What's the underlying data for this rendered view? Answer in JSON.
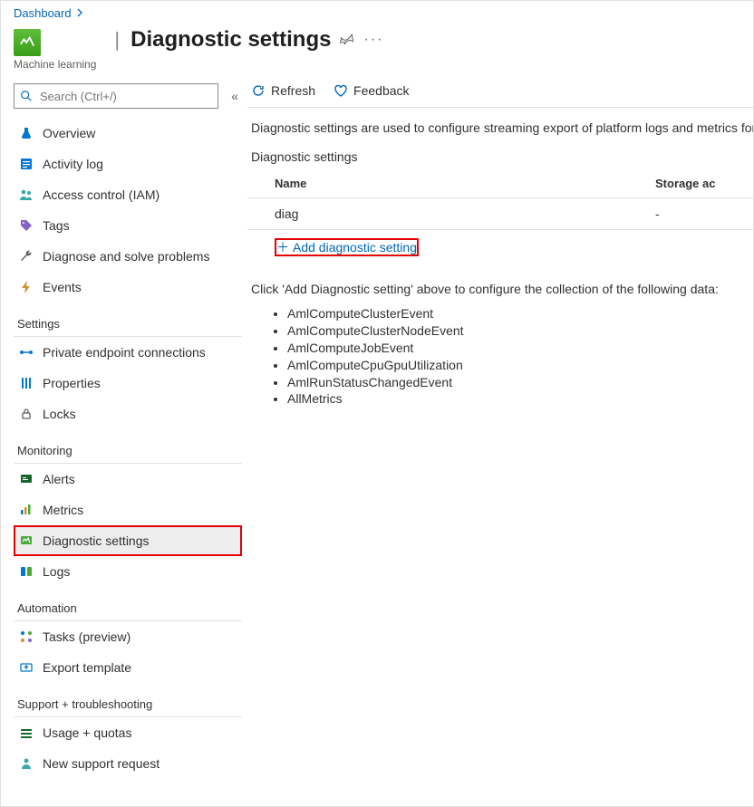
{
  "breadcrumb": {
    "dashboard": "Dashboard"
  },
  "resource": {
    "subtitle": "Machine learning"
  },
  "page": {
    "title": "Diagnostic settings"
  },
  "search": {
    "placeholder": "Search (Ctrl+/)"
  },
  "toolbar": {
    "refresh": "Refresh",
    "feedback": "Feedback"
  },
  "nav": {
    "top": {
      "overview": "Overview",
      "activitylog": "Activity log",
      "iam": "Access control (IAM)",
      "tags": "Tags",
      "diagnose": "Diagnose and solve problems",
      "events": "Events"
    },
    "settings_label": "Settings",
    "settings": {
      "pec": "Private endpoint connections",
      "properties": "Properties",
      "locks": "Locks"
    },
    "monitoring_label": "Monitoring",
    "monitoring": {
      "alerts": "Alerts",
      "metrics": "Metrics",
      "diag": "Diagnostic settings",
      "logs": "Logs"
    },
    "automation_label": "Automation",
    "automation": {
      "tasks": "Tasks (preview)",
      "export": "Export template"
    },
    "support_label": "Support + troubleshooting",
    "support": {
      "usage": "Usage + quotas",
      "newreq": "New support request"
    }
  },
  "main": {
    "description": "Diagnostic settings are used to configure streaming export of platform logs and metrics for a r",
    "section_heading": "Diagnostic settings",
    "col_name": "Name",
    "col_storage": "Storage ac",
    "row_name": "diag",
    "row_storage": "-",
    "add_label": "Add diagnostic setting",
    "instruction": "Click 'Add Diagnostic setting' above to configure the collection of the following data:",
    "categories": {
      "c0": "AmlComputeClusterEvent",
      "c1": "AmlComputeClusterNodeEvent",
      "c2": "AmlComputeJobEvent",
      "c3": "AmlComputeCpuGpuUtilization",
      "c4": "AmlRunStatusChangedEvent",
      "c5": "AllMetrics"
    }
  }
}
